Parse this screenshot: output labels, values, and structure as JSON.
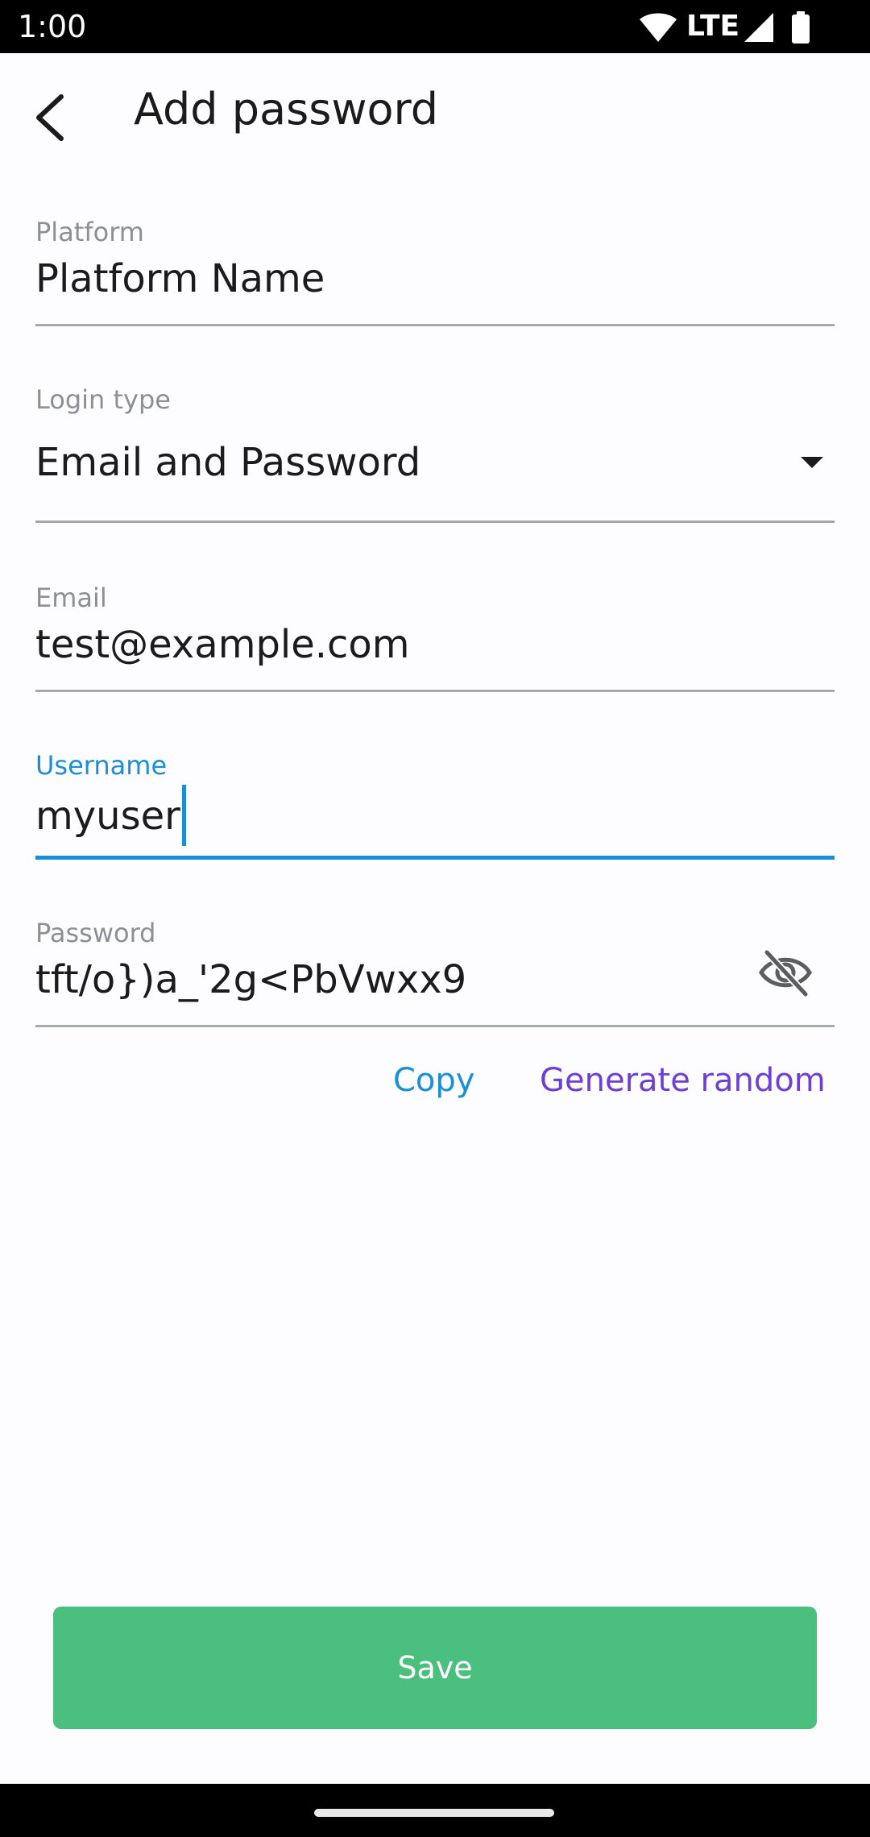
{
  "status_bar": {
    "time": "1:00",
    "network_label": "LTE",
    "icons": [
      "wifi-icon",
      "signal-icon",
      "battery-icon"
    ]
  },
  "app_bar": {
    "title": "Add password",
    "back_icon": "arrow-back-icon"
  },
  "form": {
    "platform": {
      "label": "Platform",
      "value": "Platform Name"
    },
    "login_type": {
      "label": "Login type",
      "value": "Email and Password"
    },
    "email": {
      "label": "Email",
      "value": "test@example.com"
    },
    "username": {
      "label": "Username",
      "value": "myuser"
    },
    "password": {
      "label": "Password",
      "value": "tft/o})a_'2g<PbVwxx9",
      "visibility_icon": "eye-off-icon"
    }
  },
  "actions": {
    "copy_label": "Copy",
    "generate_label": "Generate random"
  },
  "save_label": "Save",
  "colors": {
    "accent": "#1a8fd8",
    "secondary_action": "#6c3fd6",
    "save_button": "#4abf7e"
  }
}
